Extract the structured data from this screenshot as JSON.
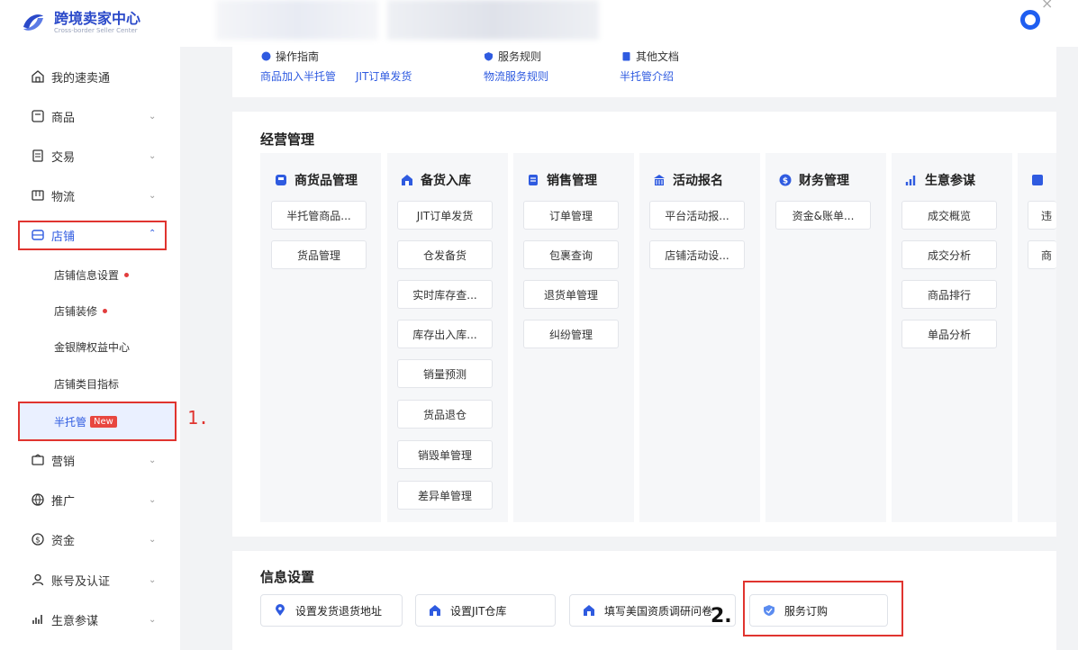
{
  "header": {
    "title": "跨境卖家中心",
    "subtitle": "Cross-border Seller Center"
  },
  "sidebar": {
    "items": [
      {
        "label": "我的速卖通",
        "icon": "home-icon"
      },
      {
        "label": "商品",
        "icon": "product-icon"
      },
      {
        "label": "交易",
        "icon": "trade-icon"
      },
      {
        "label": "物流",
        "icon": "logistics-icon"
      },
      {
        "label": "店铺",
        "icon": "store-icon"
      },
      {
        "label": "营销",
        "icon": "marketing-icon"
      },
      {
        "label": "推广",
        "icon": "globe-icon"
      },
      {
        "label": "资金",
        "icon": "money-icon"
      },
      {
        "label": "账号及认证",
        "icon": "user-icon"
      },
      {
        "label": "生意参谋",
        "icon": "chart-icon"
      }
    ],
    "store_sub": [
      "店铺信息设置",
      "店铺装修",
      "金银牌权益中心",
      "店铺类目指标",
      "半托管"
    ],
    "new_badge": "New"
  },
  "annotations": {
    "step1": "1.",
    "step2": "2."
  },
  "guide": {
    "groups": [
      {
        "head": "操作指南",
        "links": [
          "商品加入半托管",
          "JIT订单发货"
        ]
      },
      {
        "head": "服务规则",
        "links": [
          "物流服务规则"
        ]
      },
      {
        "head": "其他文档",
        "links": [
          "半托管介绍"
        ]
      }
    ]
  },
  "business": {
    "title": "经营管理",
    "columns": [
      {
        "head": "商货品管理",
        "buttons": [
          "半托管商品...",
          "货品管理"
        ]
      },
      {
        "head": "备货入库",
        "buttons": [
          "JIT订单发货",
          "仓发备货",
          "实时库存查...",
          "库存出入库...",
          "销量预测",
          "货品退仓",
          "销毁单管理",
          "差异单管理"
        ]
      },
      {
        "head": "销售管理",
        "buttons": [
          "订单管理",
          "包裹查询",
          "退货单管理",
          "纠纷管理"
        ]
      },
      {
        "head": "活动报名",
        "buttons": [
          "平台活动报...",
          "店铺活动设..."
        ]
      },
      {
        "head": "财务管理",
        "buttons": [
          "资金&账单..."
        ]
      },
      {
        "head": "生意参谋",
        "buttons": [
          "成交概览",
          "成交分析",
          "商品排行",
          "单品分析"
        ]
      },
      {
        "head": "",
        "buttons": [
          "违",
          "商"
        ]
      }
    ]
  },
  "info": {
    "title": "信息设置",
    "buttons": [
      "设置发货退货地址",
      "设置JIT仓库",
      "填写美国资质调研问卷",
      "服务订购"
    ]
  },
  "colors": {
    "accent": "#2f5be0",
    "highlight": "#e0342f"
  }
}
